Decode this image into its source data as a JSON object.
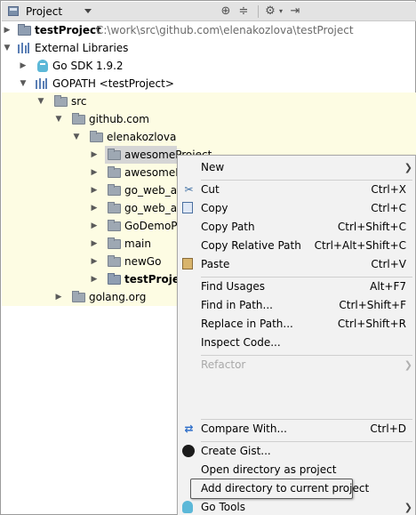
{
  "toolbar": {
    "title": "Project",
    "icons": [
      "locate-target-icon",
      "collapse-all-icon",
      "settings-gear-icon",
      "hide-panel-icon"
    ]
  },
  "tree": {
    "rows": [
      {
        "label": "testProject",
        "path": "C:\\work\\src\\github.com\\elenakozlova\\testProject"
      },
      {
        "label": "External Libraries"
      },
      {
        "label": "Go SDK 1.9.2"
      },
      {
        "label": "GOPATH <testProject>"
      },
      {
        "label": "src"
      },
      {
        "label": "github.com"
      },
      {
        "label": "elenakozlova"
      },
      {
        "label": "awesomeProject"
      },
      {
        "label": "awesomePr"
      },
      {
        "label": "go_web_app"
      },
      {
        "label": "go_web_app"
      },
      {
        "label": "GoDemoPro"
      },
      {
        "label": "main"
      },
      {
        "label": "newGo"
      },
      {
        "label": "testProject"
      },
      {
        "label": "golang.org"
      }
    ]
  },
  "menu": {
    "new": "New",
    "cut": "Cut",
    "cut_short": "Ctrl+X",
    "copy": "Copy",
    "copy_short": "Ctrl+C",
    "copy_path": "Copy Path",
    "copy_path_short": "Ctrl+Shift+C",
    "copy_rel": "Copy Relative Path",
    "copy_rel_short": "Ctrl+Alt+Shift+C",
    "paste": "Paste",
    "paste_short": "Ctrl+V",
    "find_usages": "Find Usages",
    "find_usages_short": "Alt+F7",
    "find_in_path": "Find in Path...",
    "find_in_path_short": "Ctrl+Shift+F",
    "replace_in_path": "Replace in Path...",
    "replace_in_path_short": "Ctrl+Shift+R",
    "inspect": "Inspect Code...",
    "refactor": "Refactor",
    "compare": "Compare With...",
    "compare_short": "Ctrl+D",
    "gist": "Create Gist...",
    "open_dir": "Open directory as project",
    "add_dir": "Add directory to current project",
    "go_tools": "Go Tools"
  }
}
